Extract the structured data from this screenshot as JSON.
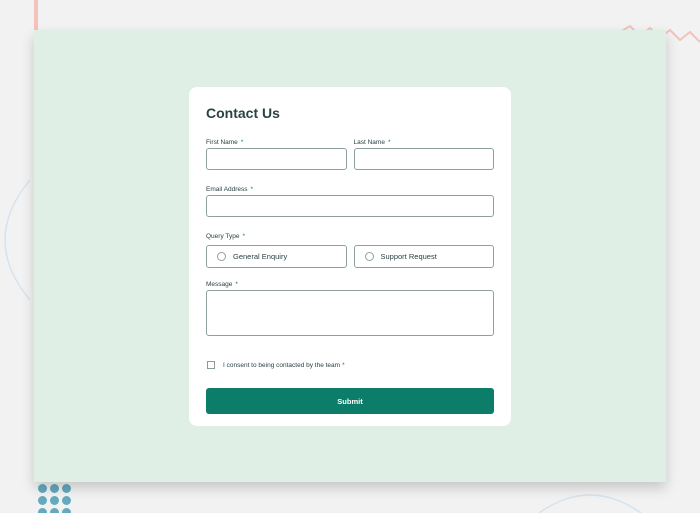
{
  "form": {
    "title": "Contact Us",
    "required_marker": "*",
    "first_name": {
      "label": "First Name",
      "value": ""
    },
    "last_name": {
      "label": "Last Name",
      "value": ""
    },
    "email": {
      "label": "Email Address",
      "value": ""
    },
    "query_type": {
      "label": "Query Type",
      "options": [
        "General Enquiry",
        "Support Request"
      ],
      "selected": null
    },
    "message": {
      "label": "Message",
      "value": ""
    },
    "consent": {
      "label": "I consent to being contacted by the team",
      "checked": false
    },
    "submit_label": "Submit"
  },
  "colors": {
    "background": "#f2f2f2",
    "panel": "#dfefe5",
    "card": "#ffffff",
    "accent": "#0c7d69",
    "text": "#2a4244",
    "border": "#8fa0a0"
  }
}
